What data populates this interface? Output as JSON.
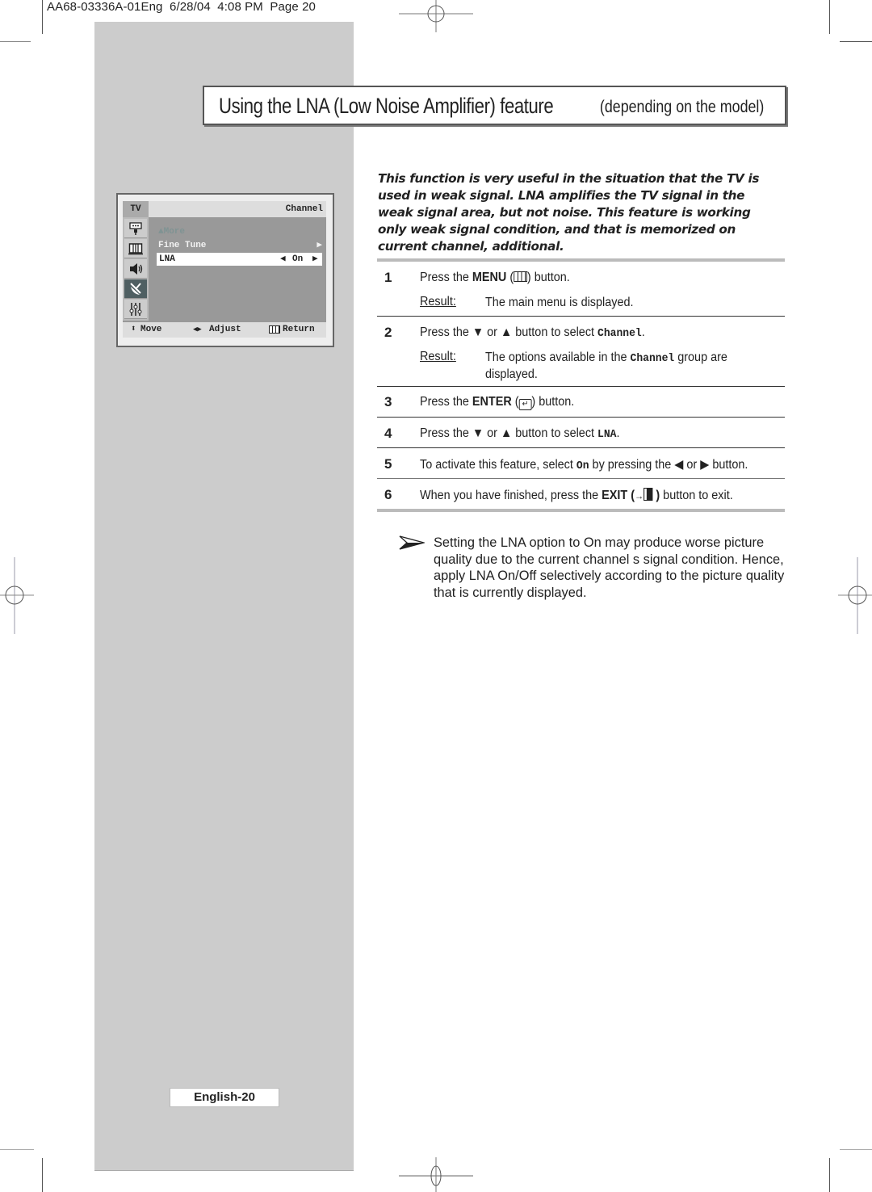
{
  "print_header": "AA68-03336A-01Eng  6/28/04  4:08 PM  Page 20",
  "title": {
    "main": "Using the LNA (Low Noise Amplifier) feature",
    "sub": "(depending on the model)"
  },
  "osd": {
    "corner_label": "TV",
    "menu_title": "Channel",
    "side_icons": [
      "input-icon",
      "picture-icon",
      "sound-icon",
      "channel-icon",
      "setup-icon"
    ],
    "selected_icon_index": 3,
    "items": {
      "more": "More",
      "fine_tune": "Fine Tune",
      "lna_label": "LNA",
      "lna_value": "On"
    },
    "footer": {
      "move": "Move",
      "adjust": "Adjust",
      "return": "Return"
    }
  },
  "intro": "This function is very useful in the situation that the TV is used in weak signal. LNA amplifies the TV signal in the weak signal area, but not noise. This feature is working only weak signal condition, and that is memorized on current channel, additional.",
  "steps": [
    {
      "num": "1",
      "pre": "Press the ",
      "bold": "MENU",
      "post": " button.",
      "result_label": "Result:",
      "result": "The main menu is displayed."
    },
    {
      "num": "2",
      "pre": "Press the ▼ or ▲ button to select ",
      "code": "Channel",
      "post": ".",
      "result_label": "Result:",
      "result_pre": "The options available in the ",
      "result_code": "Channel",
      "result_post": " group are displayed."
    },
    {
      "num": "3",
      "pre": "Press the ",
      "bold": "ENTER",
      "post": " button."
    },
    {
      "num": "4",
      "pre": "Press the ▼ or ▲ button to select ",
      "code": "LNA",
      "post": "."
    },
    {
      "num": "5",
      "pre": "To activate this feature, select ",
      "code": "On",
      "post": " by pressing the ◀ or ▶ button."
    },
    {
      "num": "6",
      "pre": "When you have finished, press the ",
      "bold": "EXIT",
      "post": " button to exit."
    }
  ],
  "note": "Setting the LNA option to  On  may produce worse picture quality due to the current channel s signal condition. Hence, apply LNA On/Off selectively according to the picture quality that is currently displayed.",
  "footer": "English-20"
}
